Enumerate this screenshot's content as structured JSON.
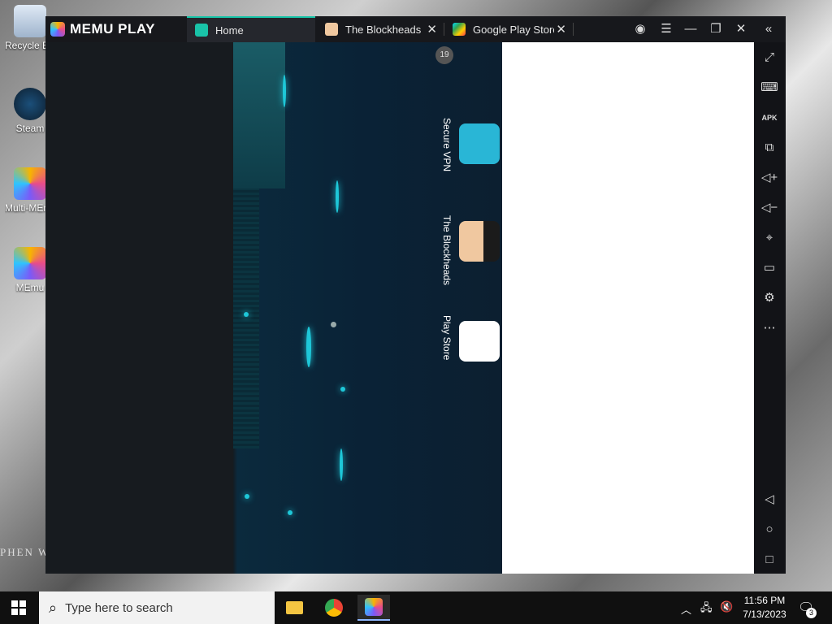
{
  "desktop": {
    "icons": [
      {
        "label": "Recycle Bin",
        "name": "recycle-bin"
      },
      {
        "label": "Steam",
        "name": "steam"
      },
      {
        "label": "Multi-MEmu",
        "name": "multi-memu"
      },
      {
        "label": "MEmu",
        "name": "memu"
      }
    ],
    "watermark_text": "PHEN W"
  },
  "emulator": {
    "brand": "MEMU PLAY",
    "tabs": [
      {
        "label": "Home",
        "active": true
      },
      {
        "label": "The Blockheads",
        "active": false
      },
      {
        "label": "Google Play Store",
        "active": false
      }
    ],
    "window_buttons": [
      "account-icon",
      "menu-icon",
      "minimize-icon",
      "restore-icon",
      "close-icon",
      "collapse-icon"
    ],
    "notification_badge": "19",
    "apps": [
      {
        "label": "Secure VPN",
        "color": "#29b6d6"
      },
      {
        "label": "The Blockheads",
        "color": "#6fa8dc"
      },
      {
        "label": "Play Store",
        "color": "#ffffff"
      }
    ],
    "sidebar_tools": [
      "fullscreen-icon",
      "keyboard-icon",
      "apk-icon",
      "multi-window-icon",
      "volume-up-icon",
      "volume-down-icon",
      "location-icon",
      "folder-icon",
      "settings-icon",
      "more-icon",
      "back-icon",
      "home-icon",
      "recents-icon"
    ],
    "apk_label": "APK",
    "accent": "#16c4a8"
  },
  "taskbar": {
    "search_placeholder": "Type here to search",
    "time": "11:56 PM",
    "date": "7/13/2023",
    "notifications_count": "3"
  }
}
